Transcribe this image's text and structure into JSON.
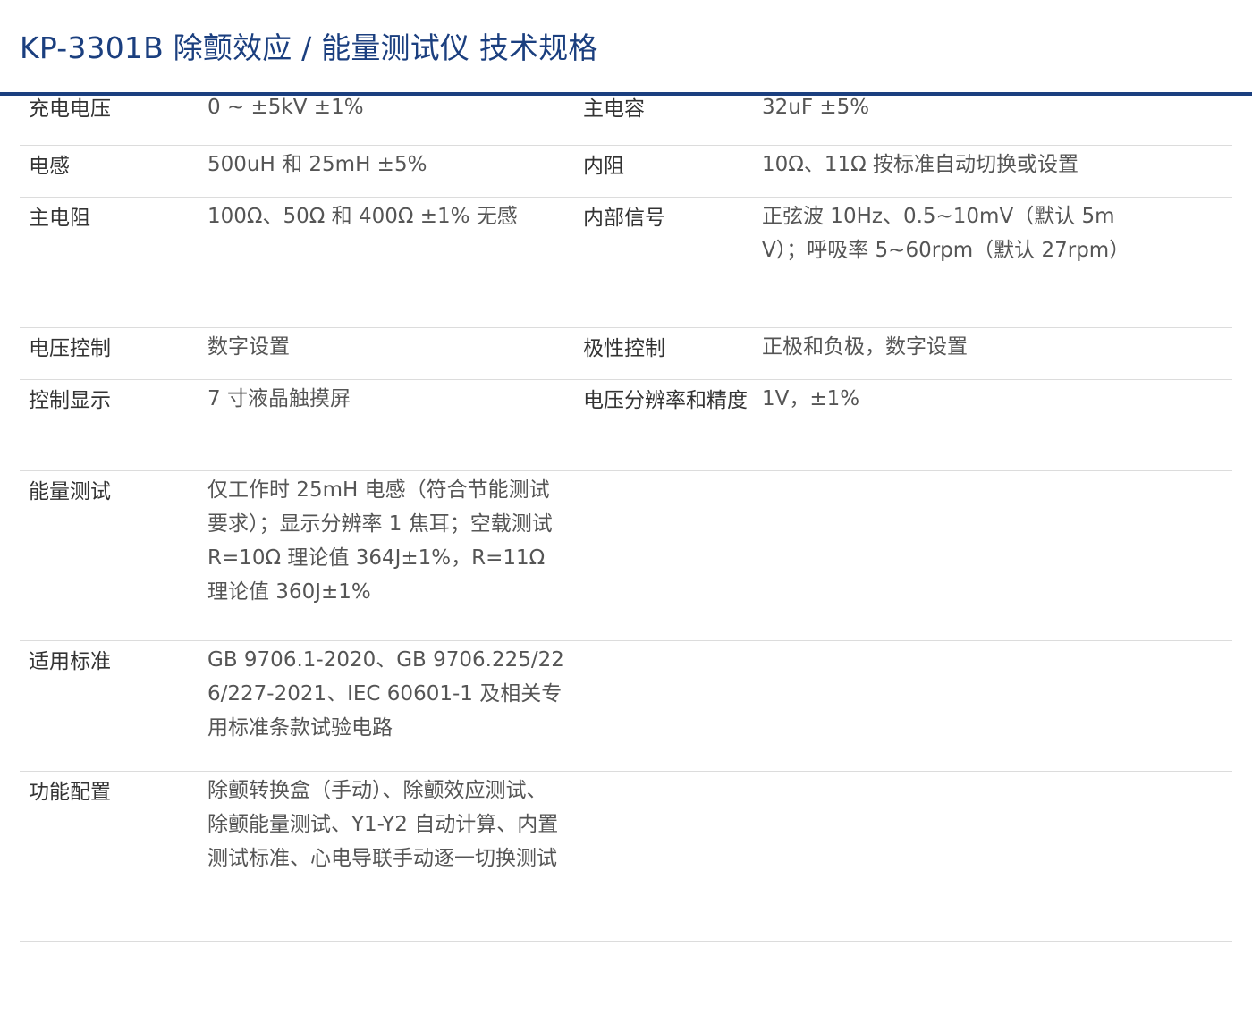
{
  "title": "KP-3301B 除颤效应 / 能量测试仪  技术规格",
  "rows": [
    {
      "label1": "充电电压",
      "value1": "0 ~ ±5kV ±1%",
      "label2": "主电容",
      "value2": "32uF ±5%"
    },
    {
      "label1": "电感",
      "value1": "500uH 和 25mH ±5%",
      "label2": "内阻",
      "value2": "10Ω、11Ω 按标准自动切换或设置"
    },
    {
      "label1": "主电阻",
      "value1": "100Ω、50Ω 和 400Ω ±1% 无感",
      "label2": "内部信号",
      "value2": "正弦波 10Hz、0.5~10mV（默认 5mV）；呼吸率 5~60rpm（默认 27rpm）"
    },
    {
      "label1": "电压控制",
      "value1": "数字设置",
      "label2": "极性控制",
      "value2": "正极和负极，数字设置"
    },
    {
      "label1": "控制显示",
      "value1": "7 寸液晶触摸屏",
      "label2": "电压分辨率和精度",
      "value2": "1V，±1%"
    },
    {
      "label1": "能量测试",
      "value1": "仅工作时 25mH 电感（符合节能测试要求）；显示分辨率 1 焦耳；空载测试 R=10Ω 理论值 364J±1%，R=11Ω 理论值 360J±1%",
      "label2": "",
      "value2": ""
    },
    {
      "label1": "适用标准",
      "value1": "GB 9706.1-2020、GB 9706.225/226/227-2021、IEC 60601-1 及相关专用标准条款试验电路",
      "label2": "",
      "value2": ""
    },
    {
      "label1": "功能配置",
      "value1": "除颤转换盒（手动）、除颤效应测试、除颤能量测试、Y1-Y2 自动计算、内置测试标准、心电导联手动逐一切换测试",
      "label2": "",
      "value2": ""
    }
  ]
}
